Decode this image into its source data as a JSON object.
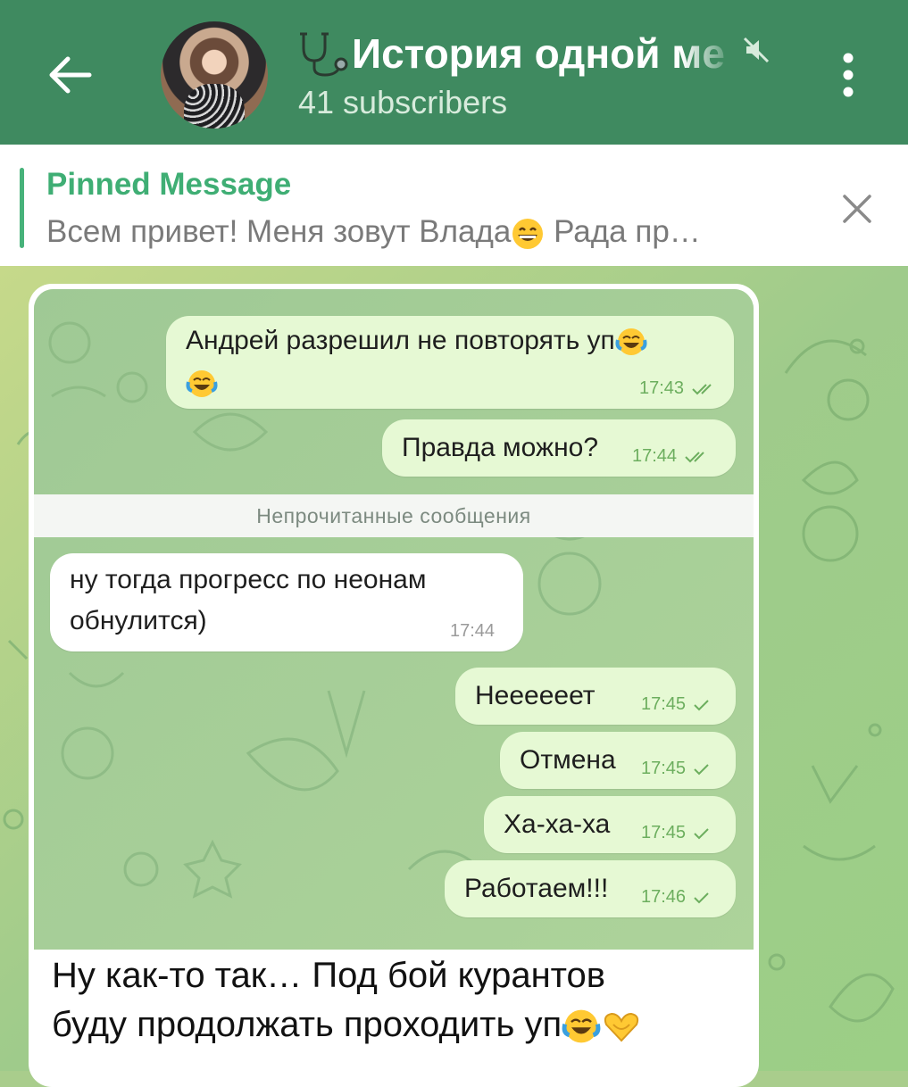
{
  "header": {
    "title": "История одной ме",
    "subtitle": "41 subscribers",
    "colors": {
      "bar": "#3f8a60",
      "pinned_accent": "#3fae74"
    }
  },
  "pinned": {
    "label": "Pinned Message",
    "text_before": "Всем привет!  Меня зовут Влада",
    "text_after": " Рада пр…"
  },
  "screenshot": {
    "messages": [
      {
        "text_line1": "Андрей разрешил не повторять уп",
        "time": "17:43",
        "direction": "out",
        "ticks": "double"
      },
      {
        "text": "Правда можно?",
        "time": "17:44",
        "direction": "out",
        "ticks": "double"
      },
      {
        "text_line1": "ну тогда прогресс по неонам",
        "text_line2": "обнулится)",
        "time": "17:44",
        "direction": "in"
      },
      {
        "text": "Неееееет",
        "time": "17:45",
        "direction": "out",
        "ticks": "single"
      },
      {
        "text": "Отмена",
        "time": "17:45",
        "direction": "out",
        "ticks": "single"
      },
      {
        "text": "Ха-ха-ха",
        "time": "17:45",
        "direction": "out",
        "ticks": "single"
      },
      {
        "text": "Работаем!!!",
        "time": "17:46",
        "direction": "out",
        "ticks": "single"
      }
    ],
    "unread_divider": "Непрочитанные сообщения"
  },
  "caption": {
    "line1": "Ну как-то так… Под бой курантов",
    "line2": "буду продолжать проходить уп"
  },
  "icons": [
    "back-arrow-icon",
    "stethoscope-icon",
    "mute-icon",
    "more-vertical-icon",
    "close-icon",
    "tears-of-joy-emoji",
    "grinning-emoji",
    "heart-hands-emoji"
  ]
}
